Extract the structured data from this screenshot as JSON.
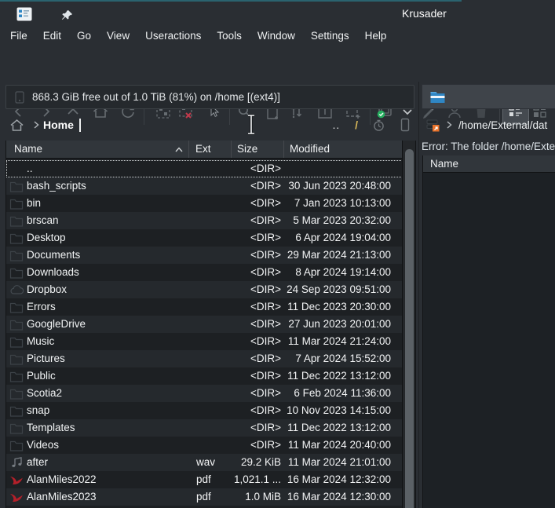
{
  "window": {
    "title": "Krusader"
  },
  "menu_bar": {
    "items": [
      "File",
      "Edit",
      "Go",
      "View",
      "Useractions",
      "Tools",
      "Window",
      "Settings",
      "Help"
    ]
  },
  "toolbar": {
    "buttons": [
      "back",
      "forward",
      "up",
      "home",
      "refresh",
      "select-group",
      "unselect-group",
      "select-pointer",
      "search",
      "new-file",
      "swap-panels",
      "unpack",
      "pack",
      "sync-browse",
      "options-dropdown",
      "edit",
      "user",
      "trash",
      "detailed-view",
      "compact-view"
    ],
    "active_view_mode": "detailed-view"
  },
  "left_panel": {
    "status_bar": {
      "text": "868.3 GiB free out of 1.0 TiB (81%) on /home [(ext4)]"
    },
    "breadcrumb": {
      "location": "Home",
      "up_label": "..",
      "root_label": "/"
    },
    "columns": {
      "name": "Name",
      "ext": "Ext",
      "size": "Size",
      "modified": "Modified"
    },
    "sort": {
      "column": "name",
      "direction": "ascending"
    },
    "rows": [
      {
        "icon": null,
        "name": "..",
        "ext": "",
        "size": "<DIR>",
        "modified": "",
        "cursored": true
      },
      {
        "icon": "folder-icon",
        "name": "bash_scripts",
        "ext": "",
        "size": "<DIR>",
        "modified": "30 Jun 2023 20:48:00"
      },
      {
        "icon": "folder-icon",
        "name": "bin",
        "ext": "",
        "size": "<DIR>",
        "modified": "7 Jan 2023 10:13:00"
      },
      {
        "icon": "folder-icon",
        "name": "brscan",
        "ext": "",
        "size": "<DIR>",
        "modified": "5 Mar 2023 20:32:00"
      },
      {
        "icon": "folder-icon",
        "name": "Desktop",
        "ext": "",
        "size": "<DIR>",
        "modified": "6 Apr 2024 19:04:00"
      },
      {
        "icon": "folder-icon",
        "name": "Documents",
        "ext": "",
        "size": "<DIR>",
        "modified": "29 Mar 2024 21:13:00"
      },
      {
        "icon": "folder-icon",
        "name": "Downloads",
        "ext": "",
        "size": "<DIR>",
        "modified": "8 Apr 2024 19:14:00"
      },
      {
        "icon": "cloud-folder-icon",
        "name": "Dropbox",
        "ext": "",
        "size": "<DIR>",
        "modified": "24 Sep 2023 09:51:00"
      },
      {
        "icon": "folder-icon",
        "name": "Errors",
        "ext": "",
        "size": "<DIR>",
        "modified": "11 Dec 2023 20:30:00"
      },
      {
        "icon": "folder-icon",
        "name": "GoogleDrive",
        "ext": "",
        "size": "<DIR>",
        "modified": "27 Jun 2023 20:01:00"
      },
      {
        "icon": "folder-icon",
        "name": "Music",
        "ext": "",
        "size": "<DIR>",
        "modified": "11 Mar 2024 21:24:00"
      },
      {
        "icon": "folder-icon",
        "name": "Pictures",
        "ext": "",
        "size": "<DIR>",
        "modified": "7 Apr 2024 15:52:00"
      },
      {
        "icon": "folder-icon",
        "name": "Public",
        "ext": "",
        "size": "<DIR>",
        "modified": "11 Dec 2022 13:12:00"
      },
      {
        "icon": "folder-icon",
        "name": "Scotia2",
        "ext": "",
        "size": "<DIR>",
        "modified": "6 Feb 2024 11:36:00"
      },
      {
        "icon": "folder-icon",
        "name": "snap",
        "ext": "",
        "size": "<DIR>",
        "modified": "10 Nov 2023 14:15:00"
      },
      {
        "icon": "folder-icon",
        "name": "Templates",
        "ext": "",
        "size": "<DIR>",
        "modified": "11 Dec 2022 13:12:00"
      },
      {
        "icon": "folder-icon",
        "name": "Videos",
        "ext": "",
        "size": "<DIR>",
        "modified": "11 Mar 2024 20:40:00"
      },
      {
        "icon": "audio-file-icon",
        "name": "after",
        "ext": "wav",
        "size": "29.2 KiB",
        "modified": "11 Mar 2024 21:01:00"
      },
      {
        "icon": "pdf-file-icon",
        "name": "AlanMiles2022",
        "ext": "pdf",
        "size": "1,021.1 ...",
        "modified": "16 Mar 2024 12:32:00"
      },
      {
        "icon": "pdf-file-icon",
        "name": "AlanMiles2023",
        "ext": "pdf",
        "size": "1.0 MiB",
        "modified": "16 Mar 2024 12:30:00"
      }
    ]
  },
  "right_panel": {
    "breadcrumb": {
      "path": "/home/External/dat"
    },
    "error_text": "Error: The folder /home/Exte",
    "columns": {
      "name": "Name"
    }
  },
  "colors": {
    "accent_blue": "#2f86c4",
    "pdf_red": "#b3202a",
    "ok_green": "#27ae60",
    "emblem_orange": "#e8722a",
    "root_slash_yellow": "#d9b95a",
    "cursor_dotted": "#cfd3d5"
  }
}
